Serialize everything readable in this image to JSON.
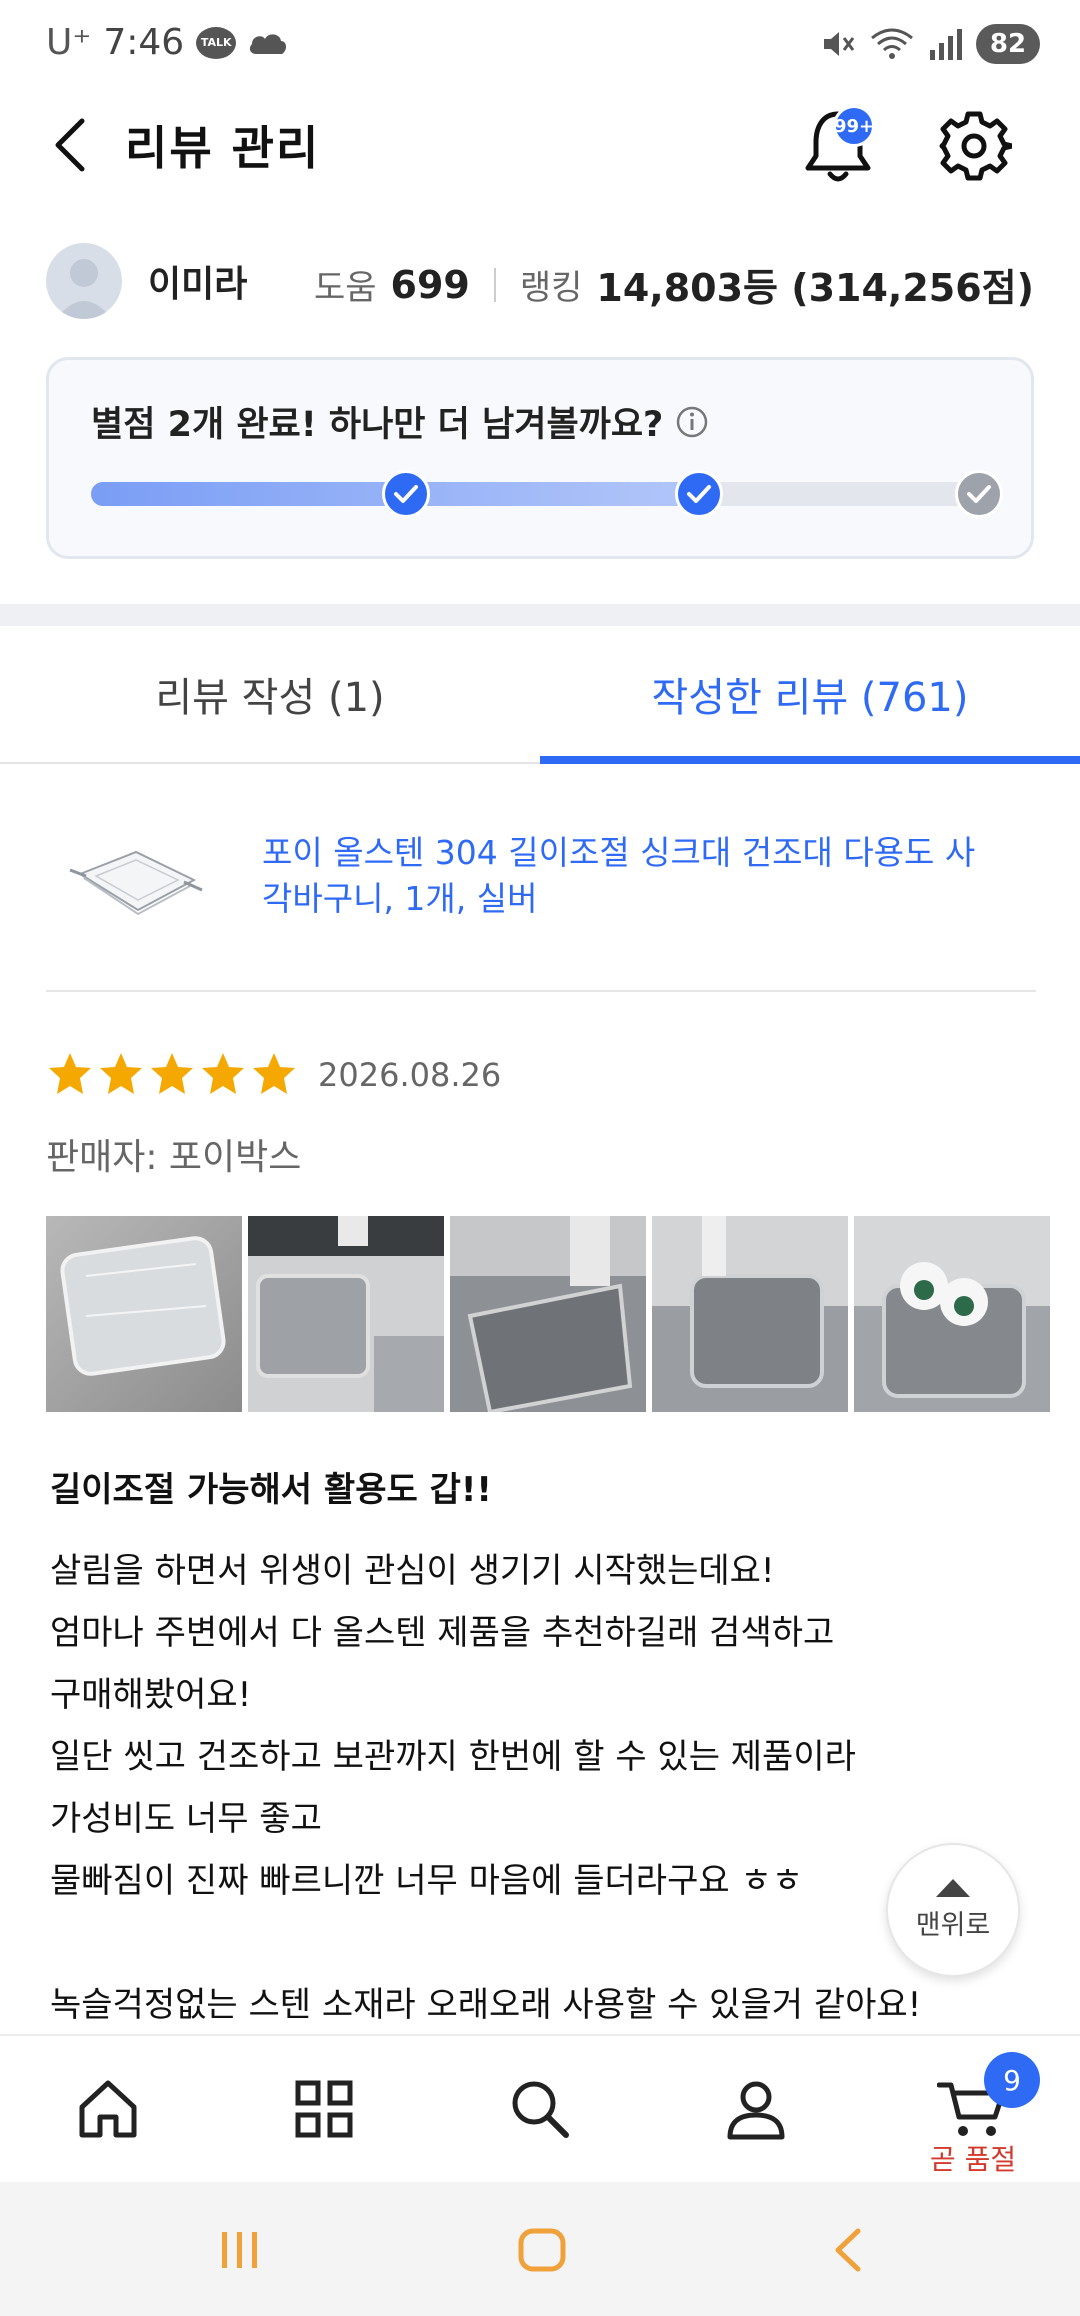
{
  "status_bar": {
    "carrier": "U⁺",
    "time": "7:46",
    "talk_badge": "TALK",
    "battery": "82"
  },
  "header": {
    "title": "리뷰 관리",
    "notification_badge": "99+"
  },
  "profile": {
    "name": "이미라",
    "help_label": "도움",
    "help_value": "699",
    "rank_label": "랭킹",
    "rank_value": "14,803등 (314,256점)"
  },
  "progress": {
    "message": "별점 2개 완료! 하나만 더 남겨볼까요?",
    "completed_steps": 2,
    "total_steps": 3,
    "colors": {
      "fill": "#7a9df5",
      "done": "#2f6af5",
      "pending": "#9ea3ab"
    }
  },
  "tabs": [
    {
      "label": "리뷰 작성 (1)",
      "active": false
    },
    {
      "label": "작성한 리뷰 (761)",
      "active": true
    }
  ],
  "product": {
    "name": "포이 올스텐 304 길이조절 싱크대 건조대 다용도 사각바구니, 1개, 실버"
  },
  "review": {
    "rating": 5,
    "date": "2026.08.26",
    "seller": "판매자: 포이박스",
    "photo_count_visible": 5,
    "title": "길이조절 가능해서 활용도 갑!!",
    "body_lines": [
      "살림을 하면서 위생이 관심이 생기기 시작했는데요!",
      "엄마나 주변에서 다 올스텐 제품을 추천하길래 검색하고",
      "구매해봤어요!",
      "일단 씻고 건조하고 보관까지 한번에 할 수 있는 제품이라",
      "가성비도 너무 좋고",
      "물빠짐이 진짜 빠르니깐 너무 마음에 들더라구요 ㅎㅎ",
      "",
      "녹슬걱정없는 스텐 소재라 오래오래 사용할 수 있을거 같아요!"
    ]
  },
  "scroll_top_button": {
    "label": "맨위로"
  },
  "bottom_nav": {
    "items": [
      "home-icon",
      "category-icon",
      "search-icon",
      "my-page-icon",
      "cart-icon"
    ],
    "cart_badge": "9",
    "cart_label": "곧 품절"
  },
  "colors": {
    "accent": "#2f6af5",
    "star": "#f5a800",
    "warning_text": "#d33a2c"
  }
}
